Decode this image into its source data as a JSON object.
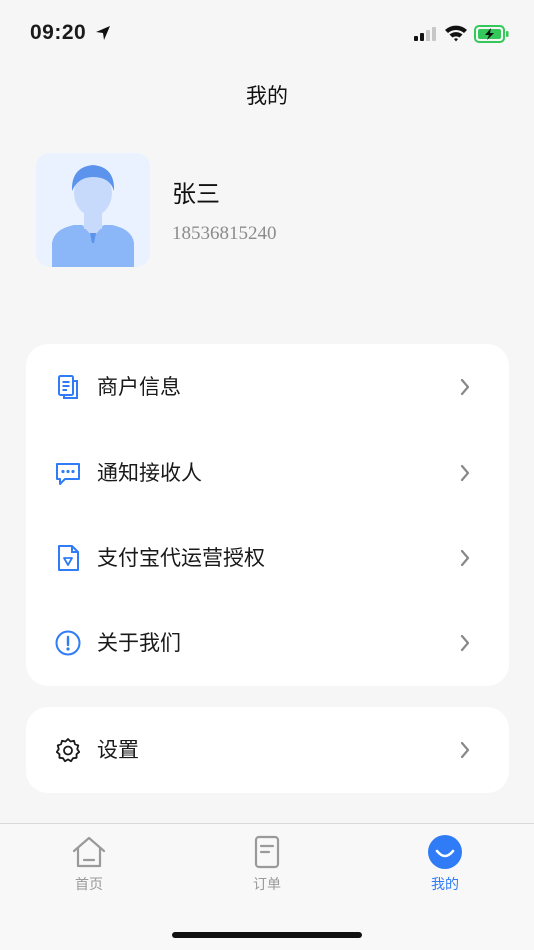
{
  "status_bar": {
    "time": "09:20"
  },
  "nav": {
    "title": "我的"
  },
  "profile": {
    "name": "张三",
    "phone": "18536815240"
  },
  "menu": {
    "items": [
      {
        "label": "商户信息",
        "icon": "merchant-info-icon"
      },
      {
        "label": "通知接收人",
        "icon": "message-icon"
      },
      {
        "label": "支付宝代运营授权",
        "icon": "alipay-auth-icon"
      },
      {
        "label": "关于我们",
        "icon": "info-icon"
      }
    ]
  },
  "settings": {
    "label": "设置",
    "icon": "gear-icon"
  },
  "tab_bar": {
    "tabs": [
      {
        "label": "首页",
        "icon": "home-icon"
      },
      {
        "label": "订单",
        "icon": "order-icon"
      },
      {
        "label": "我的",
        "icon": "profile-smile-icon"
      }
    ],
    "active_index": 2
  },
  "colors": {
    "accent": "#2f7cf6",
    "background": "#f6f6f6",
    "card": "#ffffff",
    "inactive_tab": "#9a9a9a"
  }
}
